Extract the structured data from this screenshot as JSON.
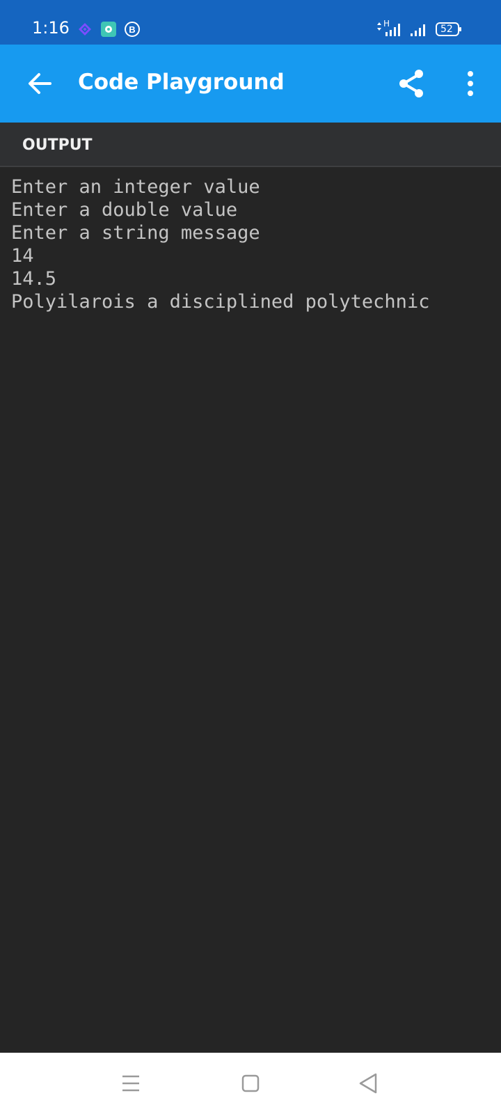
{
  "status_bar": {
    "time": "1:16",
    "notification_icons": [
      "layers-app-icon",
      "teal-app-icon",
      "whatsapp-business-icon"
    ],
    "signal_label": "H",
    "battery_level": "52",
    "colors": {
      "background": "#1565c0"
    }
  },
  "app_bar": {
    "title": "Code Playground",
    "back_icon": "arrow-left-icon",
    "share_icon": "share-icon",
    "more_icon": "more-vertical-icon",
    "colors": {
      "background": "#179af0",
      "foreground": "#ffffff"
    }
  },
  "output": {
    "header_label": "OUTPUT",
    "lines": [
      "Enter an integer value",
      "Enter a double value",
      "Enter a string message",
      "14",
      "14.5",
      "Polyilarois a disciplined polytechnic"
    ],
    "colors": {
      "background": "#252525",
      "text": "#c4c4c4"
    }
  },
  "nav_bar": {
    "buttons": [
      "recents-menu-icon",
      "home-square-icon",
      "back-triangle-icon"
    ]
  }
}
